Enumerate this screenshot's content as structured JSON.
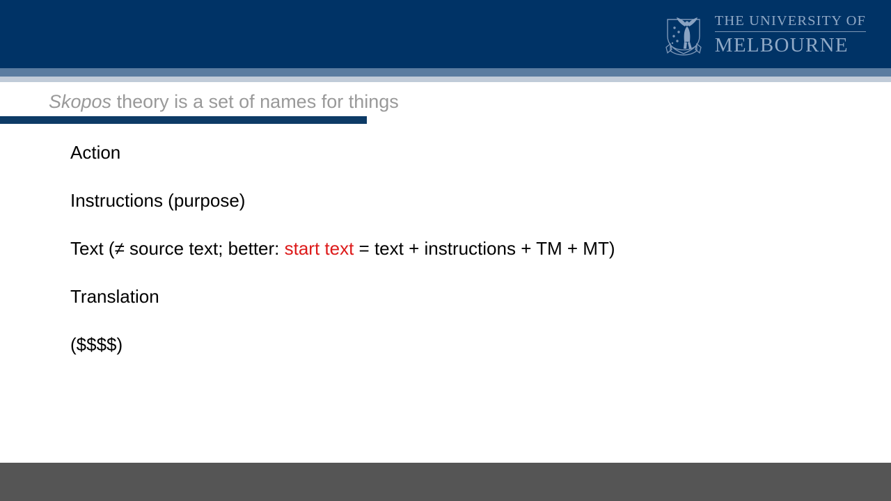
{
  "header": {
    "background_color": "#003366",
    "logo": {
      "crest_icon": "university-crest-icon",
      "line1": "THE UNIVERSITY OF",
      "line2": "MELBOURNE"
    }
  },
  "accent_bands": {
    "mid_color": "#5a7ca0",
    "light_color": "#c0cbd8"
  },
  "title": {
    "emphasis": "Skopos",
    "rest": " theory is a set of names for things",
    "color": "#999999",
    "underline_color": "#0d3b66"
  },
  "body": {
    "lines": [
      {
        "segments": [
          {
            "text": "Action",
            "color": "#000000"
          }
        ]
      },
      {
        "segments": [
          {
            "text": "Instructions (purpose)",
            "color": "#000000"
          }
        ]
      },
      {
        "segments": [
          {
            "text": "Text (≠ source text; better: ",
            "color": "#000000"
          },
          {
            "text": "start text",
            "color": "#dd1a1a"
          },
          {
            "text": " = text + instructions + TM + MT)",
            "color": "#000000"
          }
        ]
      },
      {
        "segments": [
          {
            "text": "Translation",
            "color": "#000000"
          }
        ]
      },
      {
        "segments": [
          {
            "text": "($$$$)",
            "color": "#000000"
          }
        ]
      }
    ]
  },
  "footer": {
    "background_color": "#555555"
  }
}
